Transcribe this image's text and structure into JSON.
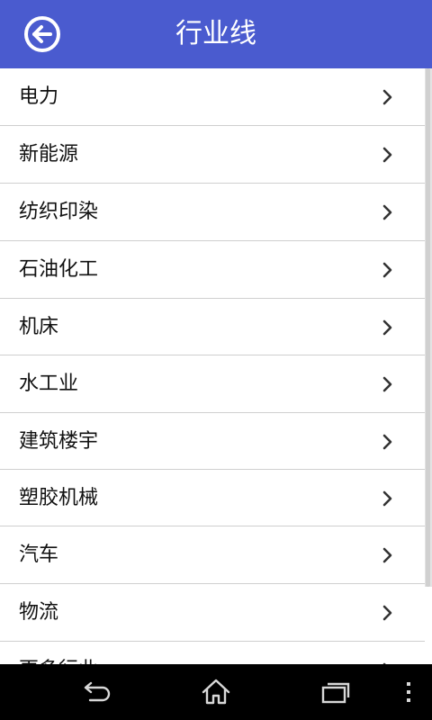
{
  "app_bar": {
    "title": "行业线",
    "back_icon": "back-arrow-circle-icon",
    "background_color": "#4a5bcf",
    "title_color": "#ffffff"
  },
  "list": {
    "items": [
      {
        "label": "电力"
      },
      {
        "label": "新能源"
      },
      {
        "label": "纺织印染"
      },
      {
        "label": "石油化工"
      },
      {
        "label": "机床"
      },
      {
        "label": "水工业"
      },
      {
        "label": "建筑楼宇"
      },
      {
        "label": "塑胶机械"
      },
      {
        "label": "汽车"
      },
      {
        "label": "物流"
      },
      {
        "label": "更多行业"
      }
    ],
    "item_icon": "chevron-right-icon",
    "divider_color": "#cfcfcf"
  },
  "nav_bar": {
    "back_icon": "system-back-icon",
    "home_icon": "home-icon",
    "recents_icon": "recent-apps-icon",
    "menu_icon": "overflow-menu-icon",
    "background_color": "#000000"
  }
}
